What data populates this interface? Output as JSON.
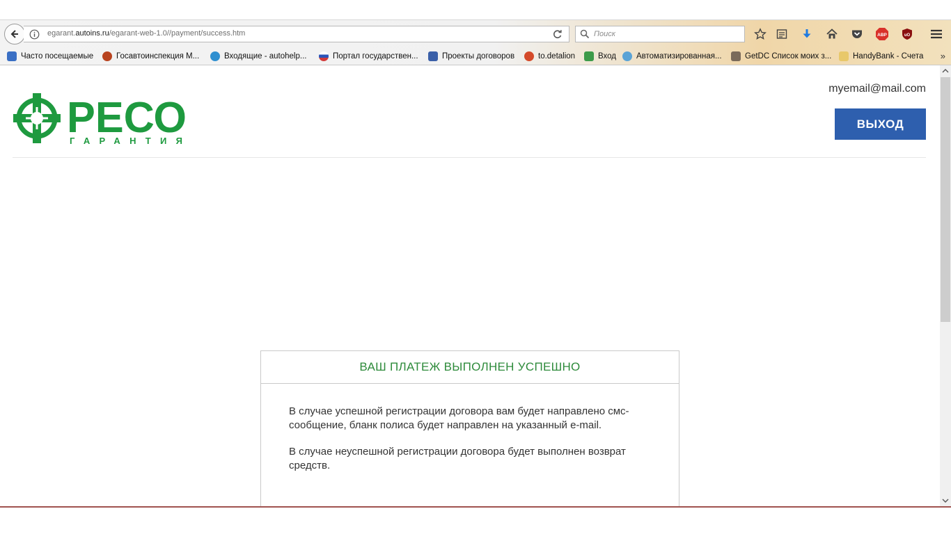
{
  "browser": {
    "url_host": "egarant.",
    "url_domain": "autoins.ru",
    "url_path": "/egarant-web-1.0//payment/success.htm",
    "search_placeholder": "Поиск"
  },
  "bookmarks": [
    {
      "label": "Часто посещаемые",
      "icon": "mostvisited-icon",
      "color": "#3a6fc4"
    },
    {
      "label": "Госавтоинспекция М...",
      "icon": "gibdd-icon",
      "color": "#b8431f"
    },
    {
      "label": "Входящие - autohelp...",
      "icon": "mail-icon",
      "color": "#2f8fd0"
    },
    {
      "label": "Портал государствен...",
      "icon": "russia-flag-icon",
      "color": "#d23b3b"
    },
    {
      "label": "Проекты договоров",
      "icon": "shield-icon",
      "color": "#3a5fa8"
    },
    {
      "label": "to.detalion",
      "icon": "gear-icon",
      "color": "#d44a2a"
    },
    {
      "label": "Вход",
      "icon": "puzzle-icon",
      "color": "#3d9b4a"
    },
    {
      "label": "Автоматизированная...",
      "icon": "cog-icon",
      "color": "#5aa3d6"
    },
    {
      "label": "GetDC Список моих з...",
      "icon": "car-icon",
      "color": "#7a6a5a"
    },
    {
      "label": "HandyBank - Счета",
      "icon": "handybank-icon",
      "color": "#e8c86a"
    }
  ],
  "header": {
    "logo_main": "РЕСО",
    "logo_sub": "ГАРАНТИЯ",
    "user_email": "myemail@mail.com",
    "logout_label": "ВЫХОД"
  },
  "card": {
    "title": "ВАШ ПЛАТЕЖ ВЫПОЛНЕН УСПЕШНО",
    "paragraph_1": "В случае успешной регистрации договора вам будет направлено смс-сообщение, бланк полиса будет направлен на указанный e-mail.",
    "paragraph_2": "В случае неуспешной регистрации договора будет выполнен возврат средств."
  },
  "colors": {
    "brand_green": "#1e9a3f",
    "title_green": "#2e8b3b",
    "button_blue": "#2e5fae"
  }
}
